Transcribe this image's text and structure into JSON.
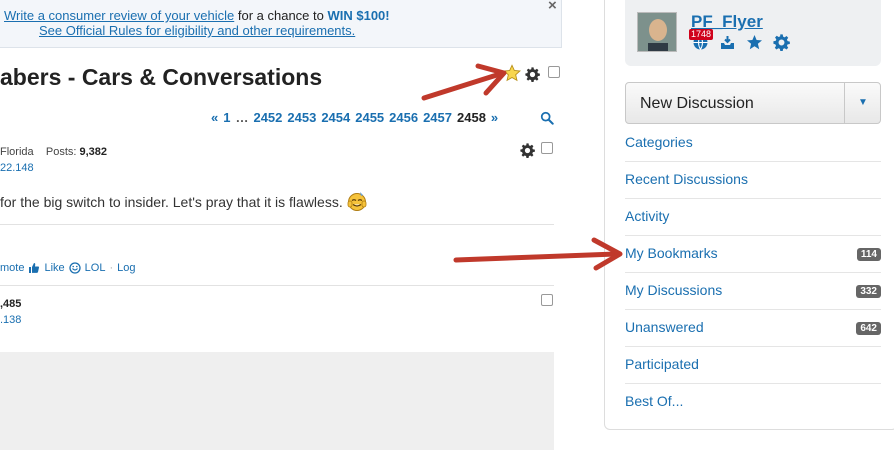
{
  "promo": {
    "link_text": "Write a consumer review of your vehicle",
    "middle_text": " for a chance to ",
    "prize_text": "WIN $100!",
    "rules_text": "See Official Rules for eligibility and other requirements.",
    "close_glyph": "×"
  },
  "discussion": {
    "title": "abers - Cars & Conversations"
  },
  "pager": {
    "prev": "«",
    "first": "1",
    "ellipsis": "…",
    "pages": [
      "2452",
      "2453",
      "2454",
      "2455",
      "2456",
      "2457"
    ],
    "current": "2458",
    "next": "»"
  },
  "post1": {
    "location": "Florida",
    "posts_label": "Posts:",
    "posts_count": "9,382",
    "ip_fragment": "22.148",
    "body": "for the big switch to insider.  Let's pray that it is flawless.",
    "reactions": {
      "promote": "mote",
      "like": "Like",
      "lol": "LOL",
      "sep": "·",
      "log": "Log"
    }
  },
  "post2": {
    "count_fragment": ",485",
    "ip_fragment": ".138"
  },
  "user": {
    "name": "PF_Flyer",
    "notification_count": "1748"
  },
  "sidebar": {
    "new_discussion": "New Discussion",
    "caret": "▼",
    "items": [
      {
        "label": "Categories",
        "count": ""
      },
      {
        "label": "Recent Discussions",
        "count": ""
      },
      {
        "label": "Activity",
        "count": ""
      },
      {
        "label": "My Bookmarks",
        "count": "114"
      },
      {
        "label": "My Discussions",
        "count": "332"
      },
      {
        "label": "Unanswered",
        "count": "642"
      },
      {
        "label": "Participated",
        "count": ""
      },
      {
        "label": "Best Of...",
        "count": ""
      }
    ]
  },
  "colors": {
    "link": "#1a6fb0",
    "annotation_arrow": "#c0392b",
    "badge": "#666666",
    "notification": "#d0021b"
  },
  "icons": [
    "star-icon",
    "gear-icon",
    "search-icon",
    "globe-icon",
    "inbox-icon",
    "bookmark-star-icon",
    "settings-gear-icon",
    "thumbs-up-icon",
    "smiley-icon",
    "emoji-icon",
    "close-icon",
    "caret-down-icon"
  ]
}
